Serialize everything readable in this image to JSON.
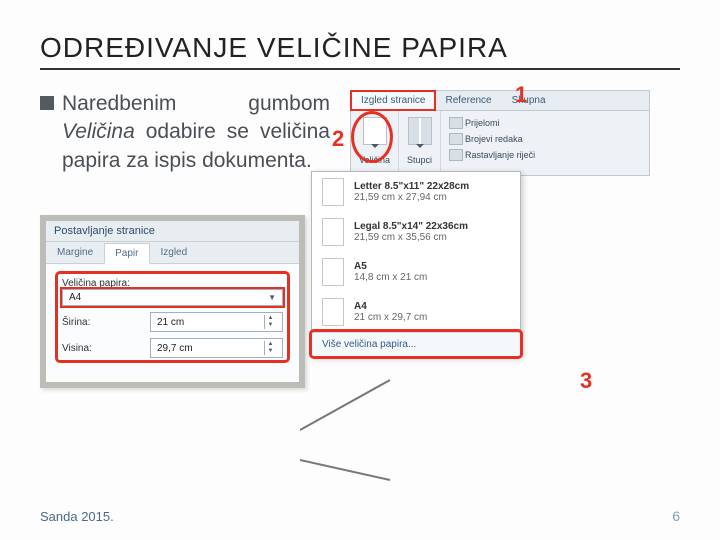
{
  "title": "ODREĐIVANJE VELIČINE PAPIRA",
  "body": {
    "line1": "Naredbenim gumbom",
    "line2_em": "Veličina",
    "line2_rest": " odabire se veličina papira za ispis dokumenta."
  },
  "dialog": {
    "title": "Postavljanje stranice",
    "tabs": [
      "Margine",
      "Papir",
      "Izgled"
    ],
    "active_tab": "Papir",
    "field_size_label": "Veličina papira:",
    "field_size_value": "A4",
    "field_width_label": "Širina:",
    "field_width_value": "21 cm",
    "field_height_label": "Visina:",
    "field_height_value": "29,7 cm"
  },
  "ribbon": {
    "tab_active": "Izgled stranice",
    "tab_other": "Reference",
    "tab_group": "Skupna",
    "big_btn": "Veličina",
    "group2_btn": "Stupci",
    "mini1": "Prijelomi",
    "mini2": "Brojevi redaka",
    "mini3": "Rastavljanje riječi"
  },
  "dropdown": {
    "items": [
      {
        "name": "Letter 8.5\"x11\" 22x28cm",
        "dim": "21,59 cm x 27,94 cm"
      },
      {
        "name": "Legal 8.5\"x14\" 22x36cm",
        "dim": "21,59 cm x 35,56 cm"
      },
      {
        "name": "A5",
        "dim": "14,8 cm x 21 cm"
      },
      {
        "name": "A4",
        "dim": "21 cm x 29,7 cm"
      }
    ],
    "footer": "Više veličina papira..."
  },
  "callouts": {
    "c1": "1",
    "c2": "2",
    "c3": "3"
  },
  "footer": {
    "left": "Sanda 2015.",
    "right": "6"
  }
}
